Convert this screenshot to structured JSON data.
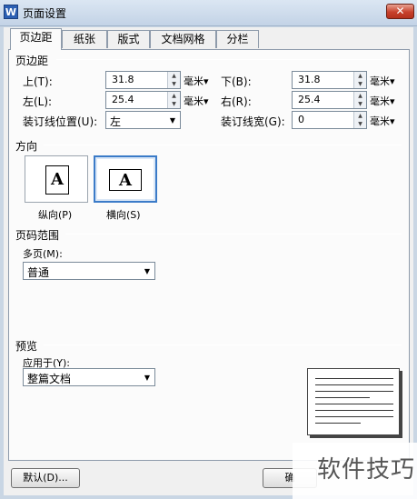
{
  "window": {
    "title": "页面设置",
    "app_icon_letter": "W",
    "close_glyph": "✕"
  },
  "tabs": [
    {
      "label": "页边距",
      "active": true
    },
    {
      "label": "纸张"
    },
    {
      "label": "版式"
    },
    {
      "label": "文档网格"
    },
    {
      "label": "分栏"
    }
  ],
  "margins": {
    "section_label": "页边距",
    "top": {
      "label": "上(T):",
      "value": "31.8",
      "unit": "毫米▾"
    },
    "bottom": {
      "label": "下(B):",
      "value": "31.8",
      "unit": "毫米▾"
    },
    "left": {
      "label": "左(L):",
      "value": "25.4",
      "unit": "毫米▾"
    },
    "right": {
      "label": "右(R):",
      "value": "25.4",
      "unit": "毫米▾"
    },
    "gutter_pos": {
      "label": "装订线位置(U):",
      "value": "左"
    },
    "gutter_width": {
      "label": "装订线宽(G):",
      "value": "0",
      "unit": "毫米▾"
    }
  },
  "orientation": {
    "section_label": "方向",
    "portrait": {
      "label": "纵向(P)",
      "glyph": "A"
    },
    "landscape": {
      "label": "横向(S)",
      "glyph": "A",
      "selected": true
    }
  },
  "page_range": {
    "section_label": "页码范围",
    "multi_label": "多页(M):",
    "multi_value": "普通"
  },
  "preview": {
    "section_label": "预览",
    "apply_label": "应用于(Y):",
    "apply_value": "整篇文档"
  },
  "buttons": {
    "default": "默认(D)...",
    "ok_partial": "确"
  },
  "watermark": "软件技巧"
}
